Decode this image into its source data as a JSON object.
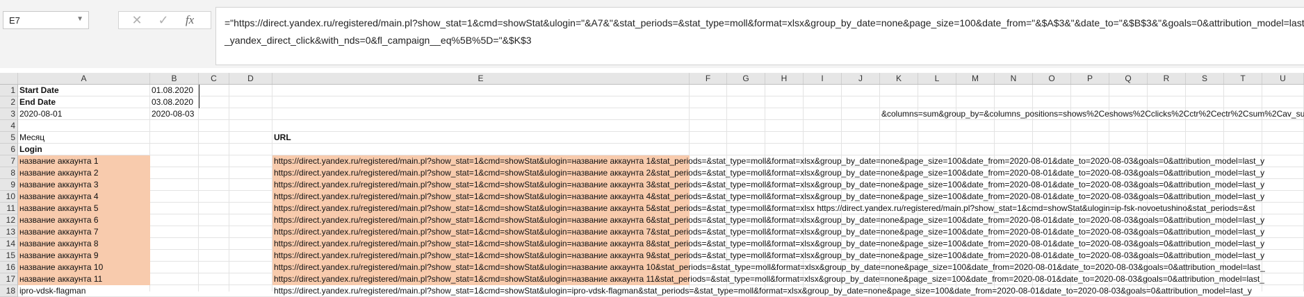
{
  "name_box": "E7",
  "formula": "=\"https://direct.yandex.ru/registered/main.pl?show_stat=1&cmd=showStat&ulogin=\"&A7&\"&stat_periods=&stat_type=moll&format=xlsx&group_by_date=none&page_size=100&date_from=\"&$A$3&\"&date_to=\"&$B$3&\"&goals=0&attribution_model=last_yandex_direct_click&with_nds=0&fl_campaign__eq%5B%5D=\"&$K$3",
  "columns": [
    "A",
    "B",
    "C",
    "D",
    "E",
    "F",
    "G",
    "H",
    "I",
    "J",
    "K",
    "L",
    "M",
    "N",
    "O",
    "P",
    "Q",
    "R",
    "S",
    "T",
    "U"
  ],
  "rows": [
    "1",
    "2",
    "3",
    "4",
    "5",
    "6",
    "7",
    "8",
    "9",
    "10",
    "11",
    "12",
    "13",
    "14",
    "15",
    "16",
    "17",
    "18"
  ],
  "cells": {
    "A1": "Start Date",
    "B1": "01.08.2020",
    "A2": "End Date",
    "B2": "03.08.2020",
    "A3": "2020-08-01",
    "B3": "2020-08-03",
    "K3": "&columns=sum&group_by=&columns_positions=shows%2Ceshows%2Cclicks%2Cctr%2Cectr%2Csum%2Cav_su",
    "A5": "Месяц",
    "E5": "URL",
    "A6": "Login"
  },
  "accounts": [
    {
      "a": "название аккаунта 1",
      "e": "https://direct.yandex.ru/registered/main.pl?show_stat=1&cmd=showStat&ulogin=название аккаунта 1&stat_periods=&stat_type=moll&format=xlsx&group_by_date=none&page_size=100&date_from=2020-08-01&date_to=2020-08-03&goals=0&attribution_model=last_y"
    },
    {
      "a": "название аккаунта 2",
      "e": "https://direct.yandex.ru/registered/main.pl?show_stat=1&cmd=showStat&ulogin=название аккаунта 2&stat_periods=&stat_type=moll&format=xlsx&group_by_date=none&page_size=100&date_from=2020-08-01&date_to=2020-08-03&goals=0&attribution_model=last_y"
    },
    {
      "a": "название аккаунта 3",
      "e": "https://direct.yandex.ru/registered/main.pl?show_stat=1&cmd=showStat&ulogin=название аккаунта 3&stat_periods=&stat_type=moll&format=xlsx&group_by_date=none&page_size=100&date_from=2020-08-01&date_to=2020-08-03&goals=0&attribution_model=last_y"
    },
    {
      "a": "название аккаунта 4",
      "e": "https://direct.yandex.ru/registered/main.pl?show_stat=1&cmd=showStat&ulogin=название аккаунта 4&stat_periods=&stat_type=moll&format=xlsx&group_by_date=none&page_size=100&date_from=2020-08-01&date_to=2020-08-03&goals=0&attribution_model=last_y"
    },
    {
      "a": "название аккаунта 5",
      "e": "https://direct.yandex.ru/registered/main.pl?show_stat=1&cmd=showStat&ulogin=название аккаунта 5&stat_periods=&stat_type=moll&format=xlsx https://direct.yandex.ru/registered/main.pl?show_stat=1&cmd=showStat&ulogin=ip-fsk-novoetushino&stat_periods=&st"
    },
    {
      "a": "название аккаунта 6",
      "e": "https://direct.yandex.ru/registered/main.pl?show_stat=1&cmd=showStat&ulogin=название аккаунта 6&stat_periods=&stat_type=moll&format=xlsx&group_by_date=none&page_size=100&date_from=2020-08-01&date_to=2020-08-03&goals=0&attribution_model=last_y"
    },
    {
      "a": "название аккаунта 7",
      "e": "https://direct.yandex.ru/registered/main.pl?show_stat=1&cmd=showStat&ulogin=название аккаунта 7&stat_periods=&stat_type=moll&format=xlsx&group_by_date=none&page_size=100&date_from=2020-08-01&date_to=2020-08-03&goals=0&attribution_model=last_y"
    },
    {
      "a": "название аккаунта 8",
      "e": "https://direct.yandex.ru/registered/main.pl?show_stat=1&cmd=showStat&ulogin=название аккаунта 8&stat_periods=&stat_type=moll&format=xlsx&group_by_date=none&page_size=100&date_from=2020-08-01&date_to=2020-08-03&goals=0&attribution_model=last_y"
    },
    {
      "a": "название аккаунта 9",
      "e": "https://direct.yandex.ru/registered/main.pl?show_stat=1&cmd=showStat&ulogin=название аккаунта 9&stat_periods=&stat_type=moll&format=xlsx&group_by_date=none&page_size=100&date_from=2020-08-01&date_to=2020-08-03&goals=0&attribution_model=last_y"
    },
    {
      "a": "название аккаунта 10",
      "e": "https://direct.yandex.ru/registered/main.pl?show_stat=1&cmd=showStat&ulogin=название аккаунта 10&stat_periods=&stat_type=moll&format=xlsx&group_by_date=none&page_size=100&date_from=2020-08-01&date_to=2020-08-03&goals=0&attribution_model=last_"
    },
    {
      "a": "название аккаунта 11",
      "e": "https://direct.yandex.ru/registered/main.pl?show_stat=1&cmd=showStat&ulogin=название аккаунта 11&stat_periods=&stat_type=moll&format=xlsx&group_by_date=none&page_size=100&date_from=2020-08-01&date_to=2020-08-03&goals=0&attribution_model=last_"
    },
    {
      "a": "ipro-vdsk-flagman",
      "e": "https://direct.yandex.ru/registered/main.pl?show_stat=1&cmd=showStat&ulogin=ipro-vdsk-flagman&stat_periods=&stat_type=moll&format=xlsx&group_by_date=none&page_size=100&date_from=2020-08-01&date_to=2020-08-03&goals=0&attribution_model=last_y"
    }
  ],
  "colors": {
    "account_fill": "#f8cbad",
    "header_bg": "#e6e6e6",
    "ribbon_bg": "#f3f3f3"
  },
  "icons": {
    "cancel": "close-icon",
    "enter": "check-icon",
    "function": "fx-icon",
    "dropdown": "chevron-down-icon"
  }
}
